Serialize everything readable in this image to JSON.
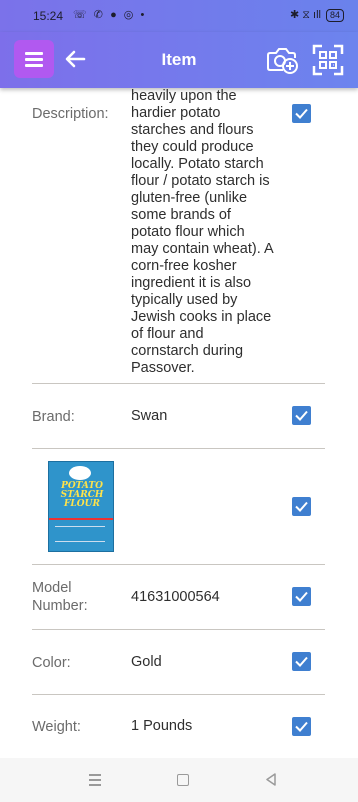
{
  "status_bar": {
    "time": "15:24",
    "notification_icons": "☏ ✆ ● ◎ •",
    "signal_icons": "✱ ⧖ ıll",
    "battery": "84"
  },
  "app_bar": {
    "title": "Item",
    "menu_icon": "hamburger-menu-icon",
    "back_icon": "arrow-left-icon",
    "camera_icon": "camera-add-icon",
    "scan_icon": "barcode-scan-icon",
    "accent_color": "#b159f0"
  },
  "fields": {
    "description": {
      "label": "Description:",
      "lines": [
        "heavily upon the",
        "hardier potato",
        "starches and flours",
        "they could produce",
        "locally. Potato starch",
        "flour / potato starch is",
        "gluten-free (unlike",
        "some brands of",
        "potato flour  which",
        "may contain wheat). A",
        "corn-free kosher",
        "ingredient  it is also",
        "typically used by",
        "Jewish cooks in place",
        "of flour and",
        "cornstarch during",
        "Passover."
      ],
      "checked": true
    },
    "brand": {
      "label": "Brand:",
      "value": "Swan",
      "checked": true
    },
    "image": {
      "checked": true,
      "product_text": [
        "POTATO",
        "STARCH",
        "FLOUR"
      ]
    },
    "model_number": {
      "label_line1": "Model",
      "label_line2": "Number:",
      "value": "41631000564",
      "checked": true
    },
    "color": {
      "label": "Color:",
      "value": "Gold",
      "checked": true
    },
    "weight": {
      "label": "Weight:",
      "value": "1 Pounds",
      "checked": true
    }
  },
  "checkbox_color": "#3f7fd0",
  "nav_bar": {
    "menu_icon": "recent-apps-icon",
    "home_icon": "home-icon",
    "back_icon": "back-triangle-icon"
  }
}
